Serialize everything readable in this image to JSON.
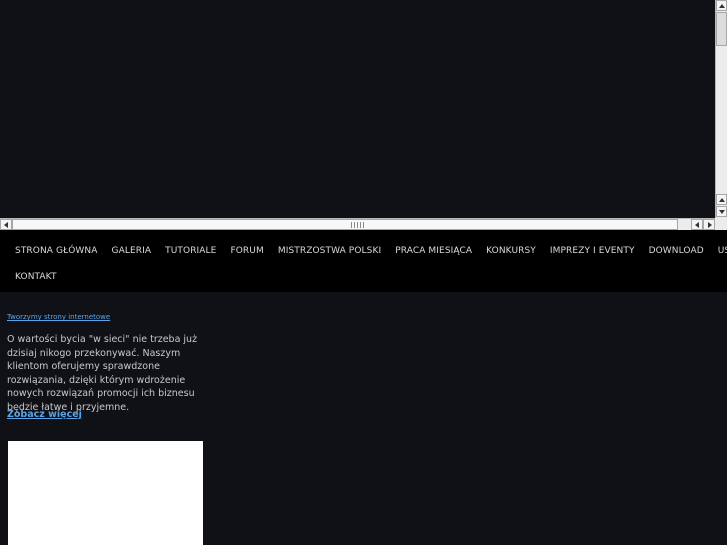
{
  "nav": {
    "row1": [
      "STRONA GŁÓWNA",
      "GALERIA",
      "TUTORIALE",
      "FORUM",
      "MISTRZOSTWA POLSKI",
      "PRACA MIESIĄCA",
      "KONKURSY",
      "IMPREZY I EVENTY",
      "DOWNLOAD",
      "USŁUGI"
    ],
    "row2": [
      "KONTAKT"
    ]
  },
  "promo": {
    "title": "Tworzymy strony internetowe",
    "text": "O wartości bycia \"w sieci\" nie trzeba już dzisiaj nikogo przekonywać. Naszym klientom oferujemy sprawdzone rozwiązania, dzięki którym wdrożenie nowych rozwiązań promocji ich biznesu będzie łatwe i przyjemne.",
    "more_label": "Zobacz więcej"
  },
  "icons": {
    "scroll_up": "arrow-up-icon",
    "scroll_down": "arrow-down-icon",
    "scroll_left": "arrow-left-icon",
    "scroll_right": "arrow-right-icon"
  },
  "colors": {
    "background": "#101117",
    "nav_background": "#000000",
    "link": "#5aa3e6",
    "text": "#c9c9c9"
  }
}
